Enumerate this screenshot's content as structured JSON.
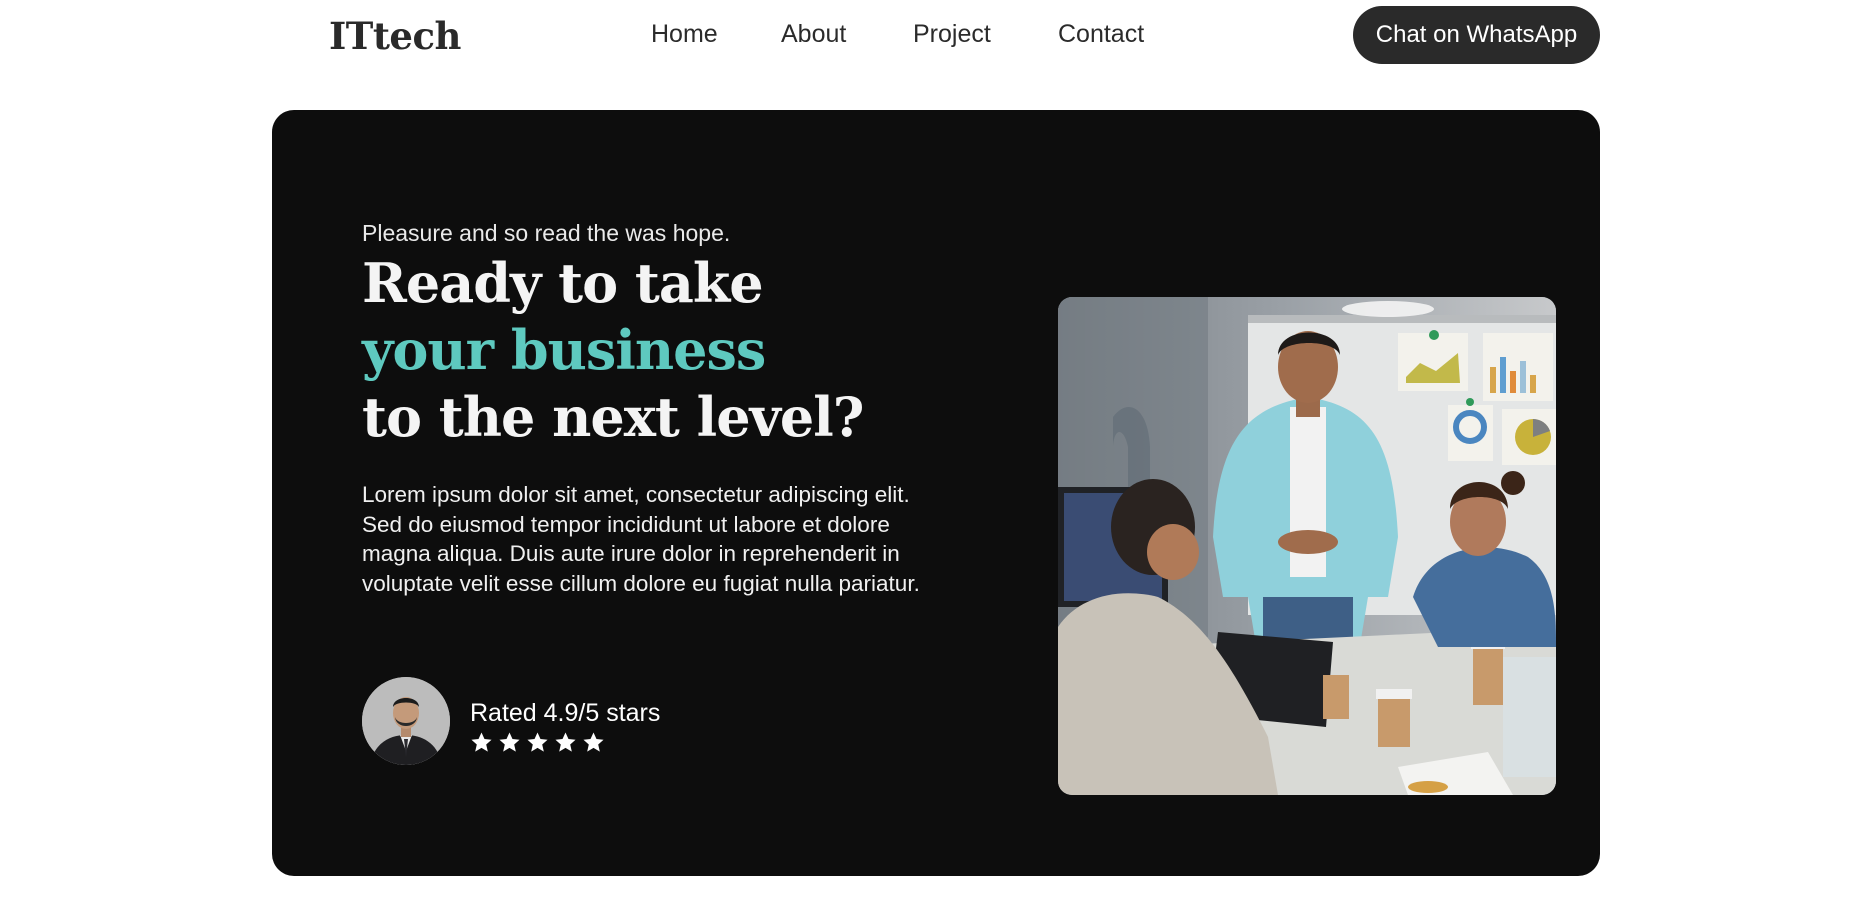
{
  "header": {
    "logo": "ITtech",
    "nav": [
      {
        "label": "Home"
      },
      {
        "label": "About"
      },
      {
        "label": "Project"
      },
      {
        "label": "Contact"
      }
    ],
    "cta_label": "Chat on WhatsApp"
  },
  "hero": {
    "eyebrow": "Pleasure and so read the was hope.",
    "headline_line1": "Ready to take",
    "headline_line2": "your business",
    "headline_line3": "to the next level?",
    "accent_color": "#5ec9bf",
    "description": "Lorem ipsum dolor sit amet, consectetur adipiscing elit. Sed do eiusmod tempor incididunt ut labore et dolore magna aliqua. Duis aute irure dolor in reprehenderit in voluptate velit esse cillum dolore eu fugiat nulla pariatur.",
    "rating": {
      "text": "Rated 4.9/5 stars",
      "stars_shown": 5
    }
  }
}
